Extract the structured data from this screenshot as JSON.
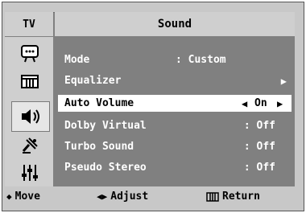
{
  "header": {
    "tab_label": "TV",
    "title": "Sound"
  },
  "sidebar": {
    "icons": [
      "picture-icon",
      "channel-icon",
      "sound-icon",
      "setup-icon",
      "input-icon"
    ],
    "active": "sound-icon"
  },
  "menu": {
    "items": [
      {
        "label": "Mode",
        "value": ": Custom"
      },
      {
        "label": "Equalizer",
        "value": "▶"
      },
      {
        "label": "Auto Volume",
        "value": "On"
      },
      {
        "label": "Dolby Virtual",
        "value": ": Off"
      },
      {
        "label": "Turbo Sound",
        "value": ": Off"
      },
      {
        "label": "Pseudo Stereo",
        "value": ": Off"
      }
    ]
  },
  "footer": {
    "move_label": "Move",
    "adjust_label": "Adjust",
    "return_label": "Return"
  },
  "colors": {
    "panel": "#808080",
    "header": "#cfcfcf",
    "selected": "#ffffff",
    "text": "#ffffff"
  }
}
